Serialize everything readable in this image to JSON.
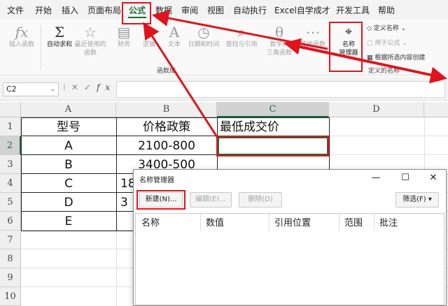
{
  "menu": {
    "tabs": [
      {
        "label": "文件"
      },
      {
        "label": "开始"
      },
      {
        "label": "插入"
      },
      {
        "label": "页面布局"
      },
      {
        "label": "公式"
      },
      {
        "label": "数据"
      },
      {
        "label": "审阅"
      },
      {
        "label": "视图"
      },
      {
        "label": "自动执行"
      },
      {
        "label": "Excel自学成才"
      },
      {
        "label": "开发工具"
      },
      {
        "label": "帮助"
      }
    ],
    "active_tab": "公式"
  },
  "ribbon": {
    "function_library": {
      "group_label": "函数库",
      "insert_function": "插入函数",
      "autosum": "自动求和",
      "recent": "最近使用的\n函数",
      "financial": "财务",
      "logical": "逻辑",
      "text": "文本",
      "datetime": "日期和时间",
      "lookup": "查找与引用",
      "math": "数学和\n三角函数",
      "more": "其他函数"
    },
    "defined_names": {
      "group_label": "定义的名称",
      "name_manager": "名称\n管理器",
      "define_name": "定义名称",
      "use_in_formula": "用于公式",
      "create_from_selection": "根据所选内容创建"
    }
  },
  "formula_bar": {
    "name_box": "C2",
    "fx": "fx",
    "value": ""
  },
  "sheet": {
    "columns": [
      "A",
      "B",
      "C",
      "D"
    ],
    "rows": [
      "1",
      "2",
      "3",
      "4",
      "5",
      "6",
      "7",
      "8",
      "9",
      "10"
    ],
    "selected_cell": "C2",
    "cells": {
      "A1": "型号",
      "B1": "价格政策",
      "C1": "最低成交价",
      "A2": "A",
      "B2": "2100-800",
      "A3": "B",
      "B3": "3400-500",
      "A4": "C",
      "B4": "18",
      "A5": "D",
      "B5": "3",
      "A6": "E"
    }
  },
  "dialog": {
    "title": "名称管理器",
    "buttons": {
      "new": "新建(N)...",
      "edit": "编辑(E)...",
      "delete": "删除(D)",
      "filter": "筛选(F)"
    },
    "list_columns": [
      "名称",
      "数值",
      "引用位置",
      "范围",
      "批注"
    ]
  },
  "colors": {
    "accent": "#1f6b3a",
    "annotation": "#e0141c"
  },
  "icons": {
    "insert_function": "fx-icon",
    "autosum": "sigma-icon",
    "name_manager": "name-tag-icon",
    "minimize": "minimize-icon",
    "maximize": "maximize-icon",
    "close": "close-icon"
  }
}
